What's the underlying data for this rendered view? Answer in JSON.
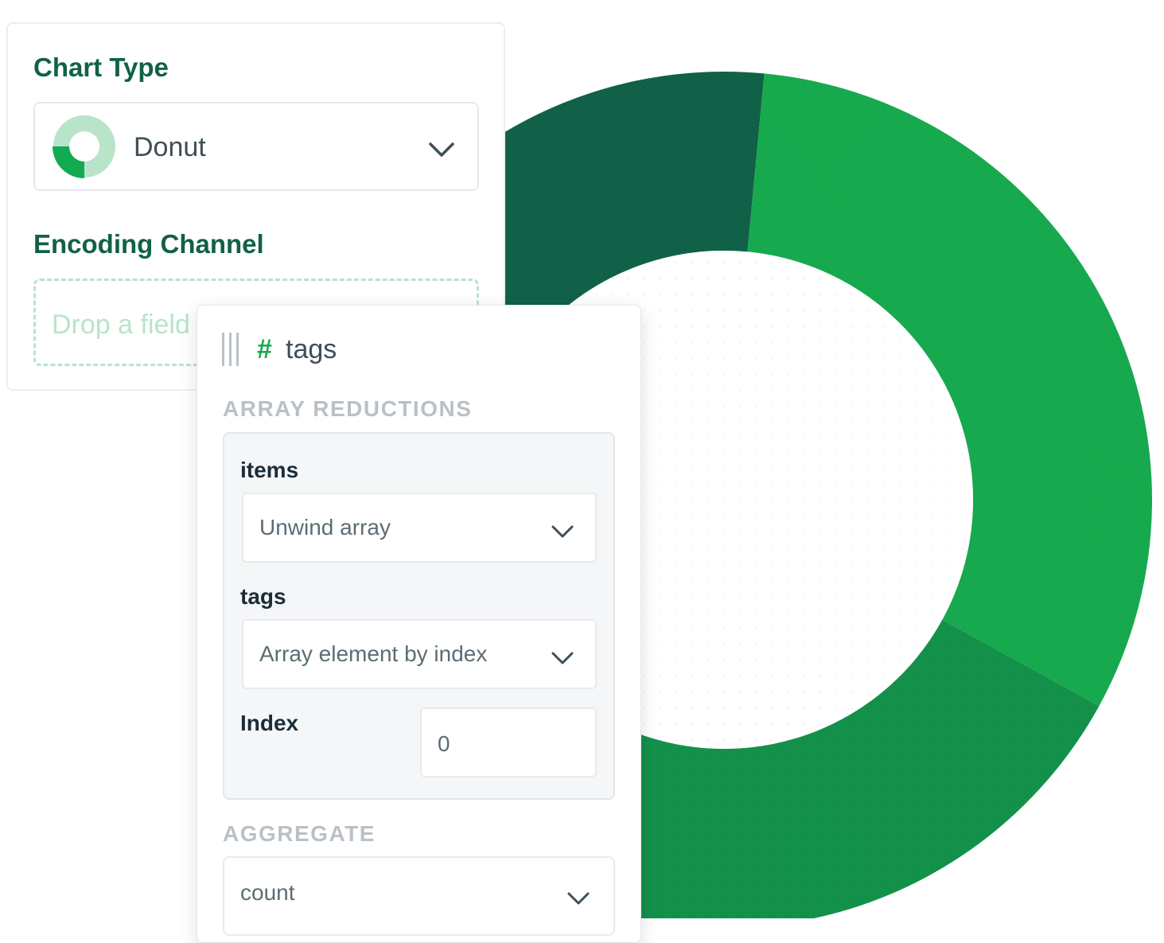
{
  "colors": {
    "accent": "#13aa52",
    "heading": "#116149",
    "dark_green": "#116149",
    "bright_green": "#17a94e",
    "mid_green": "#13914a",
    "light_green": "#b8e4c9"
  },
  "chart_panel": {
    "chart_type_title": "Chart Type",
    "selected_chart_type": "Donut",
    "chart_type_icon": "donut-chart-icon",
    "encoding_channel_title": "Encoding Channel",
    "drop_zone_text": "Drop a field"
  },
  "field_panel": {
    "grip_icon": "drag-handle-icon",
    "field_type_symbol": "#",
    "field_name": "tags",
    "array_reductions_label": "ARRAY REDUCTIONS",
    "reductions": {
      "items_label": "items",
      "items_value": "Unwind array",
      "tags_label": "tags",
      "tags_value": "Array element by index",
      "index_label": "Index",
      "index_value": "0"
    },
    "aggregate_label": "AGGREGATE",
    "aggregate_value": "count"
  },
  "chart_data": {
    "type": "pie",
    "donut": true,
    "slices": [
      {
        "value": 26.5,
        "color": "#b8e4c9"
      },
      {
        "value": 17.5,
        "color": "#116149"
      },
      {
        "value": 31.5,
        "color": "#17a94e"
      },
      {
        "value": 24.5,
        "color": "#13914a"
      }
    ]
  }
}
